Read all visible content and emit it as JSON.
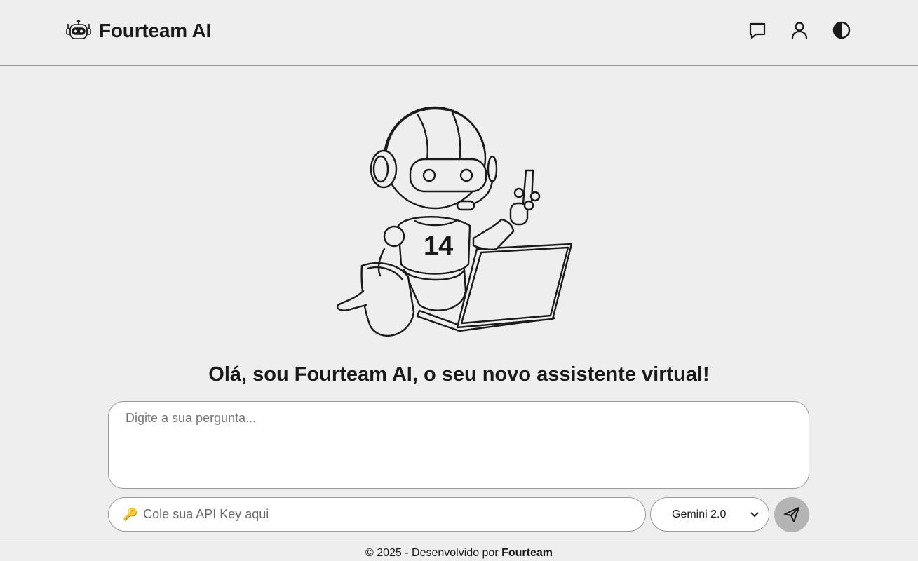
{
  "header": {
    "brand_icon": "robot-icon",
    "title": "Fourteam AI",
    "nav_icons": [
      "chat-icon",
      "user-icon",
      "contrast-icon"
    ]
  },
  "hero": {
    "illustration": "robot-with-laptop",
    "jersey_number": "14"
  },
  "main": {
    "greeting": "Olá, sou Fourteam AI, o seu novo assistente virtual!",
    "question_placeholder": "Digite a sua pergunta...",
    "apikey_icon": "key-icon",
    "apikey_placeholder": "Cole sua API Key aqui",
    "model_selected": "Gemini 2.0",
    "send_icon": "send-icon"
  },
  "footer": {
    "prefix": "© 2025 - Desenvolvido por ",
    "brand": "Fourteam"
  },
  "colors": {
    "background": "#eeeeee",
    "text": "#1a1a1a",
    "border": "#9a9a9a",
    "send_button": "#b4b4b4"
  }
}
